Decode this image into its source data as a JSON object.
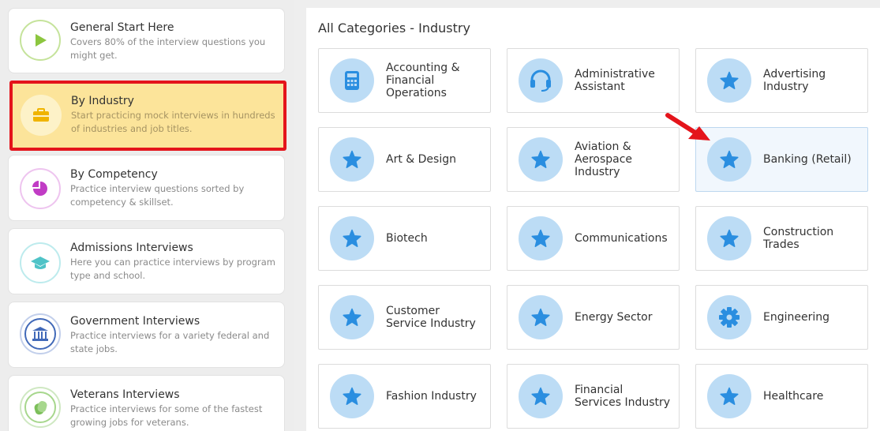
{
  "sidebar": {
    "items": [
      {
        "title": "General Start Here",
        "desc": "Covers 80% of the interview questions you might get.",
        "icon": "play-icon",
        "color": "#8cc63f"
      },
      {
        "title": "By Industry",
        "desc": "Start practicing mock interviews in hundreds of industries and job titles.",
        "icon": "briefcase-icon",
        "color": "#f0b400",
        "active": true
      },
      {
        "title": "By Competency",
        "desc": "Practice interview questions sorted by competency & skillset.",
        "icon": "pie-chart-icon",
        "color": "#c13cc5"
      },
      {
        "title": "Admissions Interviews",
        "desc": "Here you can practice interviews by program type and school.",
        "icon": "graduation-cap-icon",
        "color": "#4fc3c7"
      },
      {
        "title": "Government Interviews",
        "desc": "Practice interviews for a variety federal and state jobs.",
        "icon": "government-building-icon",
        "color": "#4169b8"
      },
      {
        "title": "Veterans Interviews",
        "desc": "Practice interviews for some of the fastest growing jobs for veterans.",
        "icon": "dog-tag-icon",
        "color": "#7cbf5a"
      }
    ]
  },
  "main": {
    "title": "All Categories - Industry",
    "tiles": [
      {
        "label": "Accounting & Financial Operations",
        "icon": "calculator-icon"
      },
      {
        "label": "Administrative Assistant",
        "icon": "headset-icon"
      },
      {
        "label": "Advertising Industry",
        "icon": "star-icon"
      },
      {
        "label": "Art & Design",
        "icon": "star-icon"
      },
      {
        "label": "Aviation & Aerospace Industry",
        "icon": "star-icon"
      },
      {
        "label": "Banking (Retail)",
        "icon": "star-icon",
        "highlighted": true
      },
      {
        "label": "Biotech",
        "icon": "star-icon"
      },
      {
        "label": "Communications",
        "icon": "star-icon"
      },
      {
        "label": "Construction Trades",
        "icon": "star-icon"
      },
      {
        "label": "Customer Service Industry",
        "icon": "star-icon"
      },
      {
        "label": "Energy Sector",
        "icon": "star-icon"
      },
      {
        "label": "Engineering",
        "icon": "gear-icon"
      },
      {
        "label": "Fashion Industry",
        "icon": "star-icon"
      },
      {
        "label": "Financial Services Industry",
        "icon": "star-icon"
      },
      {
        "label": "Healthcare",
        "icon": "star-icon"
      }
    ]
  },
  "colors": {
    "accent": "#2a8ee0",
    "icon_bg": "#bcdcf5",
    "highlight_border": "#e4141b",
    "arrow": "#e4141b"
  }
}
